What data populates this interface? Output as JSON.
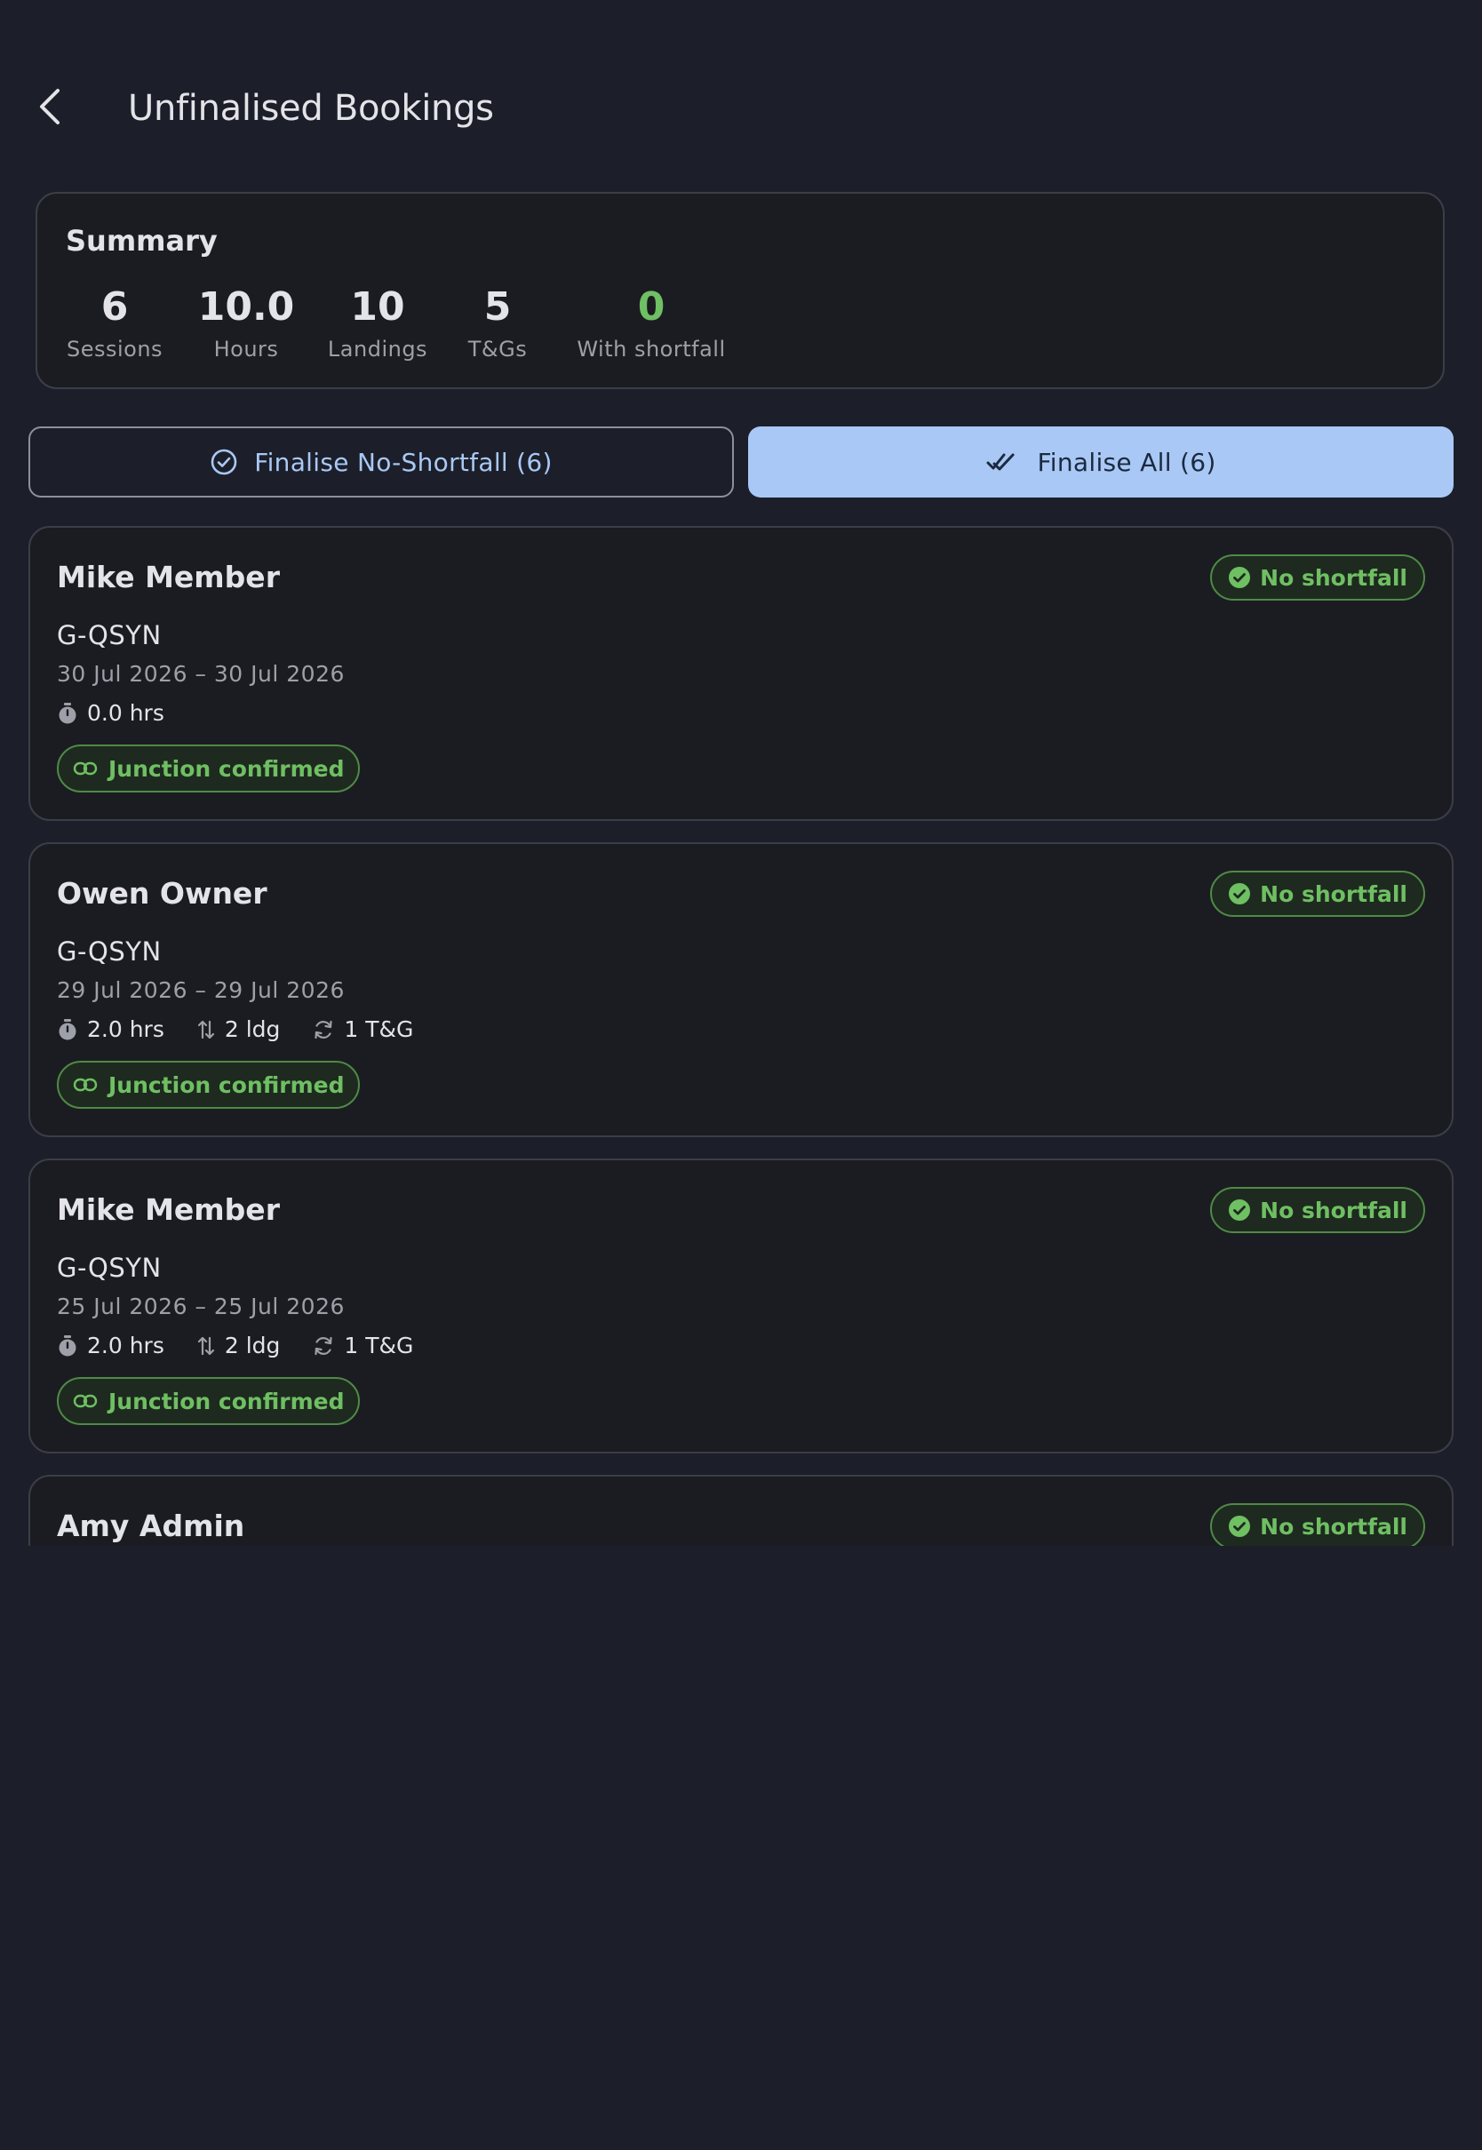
{
  "header": {
    "title": "Unfinalised Bookings"
  },
  "summary": {
    "title": "Summary",
    "stats": [
      {
        "value": "6",
        "label": "Sessions"
      },
      {
        "value": "10.0",
        "label": "Hours"
      },
      {
        "value": "10",
        "label": "Landings"
      },
      {
        "value": "5",
        "label": "T&Gs"
      },
      {
        "value": "0",
        "label": "With shortfall"
      }
    ]
  },
  "actions": {
    "finalise_no_shortfall": "Finalise No-Shortfall (6)",
    "finalise_all": "Finalise All (6)"
  },
  "bookings": [
    {
      "name": "Mike Member",
      "status": "No shortfall",
      "aircraft": "G-QSYN",
      "dates": "30 Jul 2026 – 30 Jul 2026",
      "hours": "0.0 hrs",
      "junction": "Junction confirmed"
    },
    {
      "name": "Owen Owner",
      "status": "No shortfall",
      "aircraft": "G-QSYN",
      "dates": "29 Jul 2026 – 29 Jul 2026",
      "hours": "2.0 hrs",
      "landings": "2 ldg",
      "tgs": "1 T&G",
      "junction": "Junction confirmed"
    },
    {
      "name": "Mike Member",
      "status": "No shortfall",
      "aircraft": "G-QSYN",
      "dates": "25 Jul 2026 – 25 Jul 2026",
      "hours": "2.0 hrs",
      "landings": "2 ldg",
      "tgs": "1 T&G",
      "junction": "Junction confirmed"
    },
    {
      "name": "Amy Admin",
      "status": "No shortfall"
    }
  ],
  "colors": {
    "background": "#1c1f29",
    "card": "#1b1c21",
    "accent": "#a9c8f5",
    "success": "#6fbf63"
  }
}
